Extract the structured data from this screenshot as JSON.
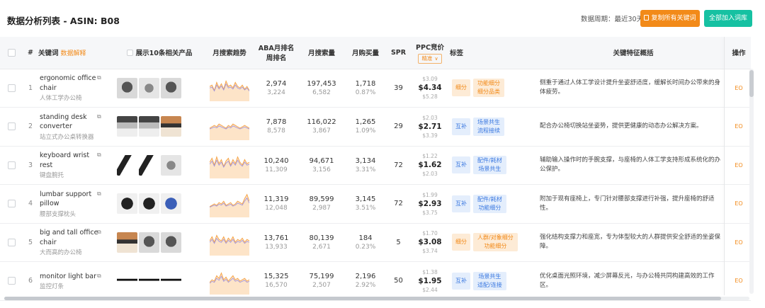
{
  "header": {
    "title": "数据分析列表 - ASIN: B08",
    "period_label": "数据周期：最近30天",
    "copy_button": "复制所有关键词",
    "add_button": "全部加入词库"
  },
  "columns": {
    "index": "#",
    "keyword": "关键词",
    "keyword_sub": "数据解释",
    "products": "展示10条相关产品",
    "trend": "月搜索趋势",
    "aba_line1": "ABA月排名",
    "aba_line2": "周排名",
    "search_volume": "月搜索量",
    "purchase": "月购买量",
    "spr": "SPR",
    "ppc": "PPC竞价",
    "ppc_select": "精准",
    "tags": "标签",
    "features": "关键特征概括",
    "op": "操作"
  },
  "colors": {
    "accent_orange": "#f28a19",
    "accent_green": "#16c1a2",
    "tag_blue": "#3a78e0"
  },
  "rows": [
    {
      "index": "1",
      "kw_en": "ergonomic office chair",
      "kw_cn": "人体工学办公椅",
      "products": [
        "p-dark",
        "p-grey",
        "p-dark"
      ],
      "trend": [
        0.55,
        0.6,
        0.4,
        0.7,
        0.5,
        0.65,
        0.45,
        0.75,
        0.55,
        0.6,
        0.5,
        0.7,
        0.55,
        0.5,
        0.6,
        0.45,
        0.55,
        0.4
      ],
      "aba_month": "2,974",
      "aba_week": "3,224",
      "volume": "197,453",
      "volume_sub": "6,582",
      "purchase": "1,718",
      "purchase_rate": "0.87%",
      "spr": "39",
      "ppc_lo": "$3.09",
      "ppc_mid": "$4.34",
      "ppc_hi": "$5.28",
      "tag_type": "细分",
      "tag_type_style": "orange",
      "tag_lines": [
        "功能细分",
        "细分品类"
      ],
      "tag_style": "orange",
      "feature": "侧重于通过人体工学设计提升坐姿舒适度，缓解长时间办公带来的身体疲劳。",
      "op": "EO"
    },
    {
      "index": "2",
      "kw_en": "standing desk converter",
      "kw_cn": "站立式办公桌转换器",
      "products": [
        "p-desk",
        "p-desk",
        "p-wood"
      ],
      "trend": [
        0.45,
        0.5,
        0.55,
        0.5,
        0.6,
        0.55,
        0.5,
        0.45,
        0.55,
        0.5,
        0.6,
        0.55,
        0.5,
        0.45,
        0.5,
        0.55,
        0.5,
        0.45
      ],
      "aba_month": "7,878",
      "aba_week": "8,578",
      "volume": "116,022",
      "volume_sub": "3,867",
      "purchase": "1,265",
      "purchase_rate": "1.09%",
      "spr": "29",
      "ppc_lo": "$2.03",
      "ppc_mid": "$2.71",
      "ppc_hi": "$3.39",
      "tag_type": "互补",
      "tag_type_style": "blue",
      "tag_lines": [
        "场景共生",
        "流程接续"
      ],
      "tag_style": "blue",
      "feature": "配合办公椅切换站坐姿势，提供更健康的动态办公解决方案。",
      "op": "EO"
    },
    {
      "index": "3",
      "kw_en": "keyboard wrist rest",
      "kw_cn": "键盘腕托",
      "products": [
        "p-wrist",
        "p-wrist",
        "p-grey"
      ],
      "trend": [
        0.6,
        0.75,
        0.5,
        0.8,
        0.55,
        0.7,
        0.45,
        0.65,
        0.75,
        0.5,
        0.7,
        0.55,
        0.8,
        0.6,
        0.5,
        0.7,
        0.55,
        0.6
      ],
      "aba_month": "10,240",
      "aba_week": "11,309",
      "volume": "94,671",
      "volume_sub": "3,156",
      "purchase": "3,134",
      "purchase_rate": "3.31%",
      "spr": "72",
      "ppc_lo": "$1.22",
      "ppc_mid": "$1.62",
      "ppc_hi": "$2.03",
      "tag_type": "互补",
      "tag_type_style": "blue",
      "tag_lines": [
        "配件/耗材",
        "场景共生"
      ],
      "tag_style": "blue",
      "feature": "辅助输入操作时的手腕支撑，与座椅的人体工学支持形成系统化的办公保护。",
      "op": "EO"
    },
    {
      "index": "4",
      "kw_en": "lumbar support pillow",
      "kw_cn": "腰部支撑枕头",
      "products": [
        "p-pill",
        "p-pill",
        "p-pillb"
      ],
      "trend": [
        0.4,
        0.45,
        0.5,
        0.45,
        0.55,
        0.5,
        0.6,
        0.45,
        0.5,
        0.55,
        0.45,
        0.5,
        0.6,
        0.55,
        0.5,
        0.7,
        0.85,
        0.6
      ],
      "aba_month": "11,319",
      "aba_week": "12,048",
      "volume": "89,599",
      "volume_sub": "2,987",
      "purchase": "3,145",
      "purchase_rate": "3.51%",
      "spr": "72",
      "ppc_lo": "$1.99",
      "ppc_mid": "$2.93",
      "ppc_hi": "$3.75",
      "tag_type": "互补",
      "tag_type_style": "blue",
      "tag_lines": [
        "配件/耗材",
        "功能细分"
      ],
      "tag_style": "blue",
      "feature": "附加于现有座椅上，专门针对腰部支撑进行补强，提升座椅的舒适性。",
      "op": "EO"
    },
    {
      "index": "5",
      "kw_en": "big and tall office chair",
      "kw_cn": "大而高的办公椅",
      "products": [
        "p-wood",
        "p-dark",
        "p-dark"
      ],
      "trend": [
        0.55,
        0.7,
        0.5,
        0.75,
        0.6,
        0.55,
        0.7,
        0.5,
        0.65,
        0.55,
        0.7,
        0.5,
        0.6,
        0.55,
        0.65,
        0.5,
        0.6,
        0.55
      ],
      "aba_month": "13,761",
      "aba_week": "13,933",
      "volume": "80,139",
      "volume_sub": "2,671",
      "purchase": "184",
      "purchase_rate": "0.23%",
      "spr": "5",
      "ppc_lo": "$1.70",
      "ppc_mid": "$3.08",
      "ppc_hi": "$3.74",
      "tag_type": "细分",
      "tag_type_style": "orange",
      "tag_lines": [
        "人群/对象细分",
        "功能细分"
      ],
      "tag_style": "orange",
      "feature": "强化结构支撑力和座宽，专为体型较大的人群提供安全舒适的坐姿保障。",
      "op": "EO"
    },
    {
      "index": "6",
      "kw_en": "monitor light bar",
      "kw_cn": "监控灯条",
      "products": [
        "p-lamp",
        "p-lamp",
        "p-lamp"
      ],
      "trend": [
        0.45,
        0.55,
        0.5,
        0.7,
        0.6,
        0.8,
        0.55,
        0.65,
        0.5,
        0.6,
        0.7,
        0.55,
        0.6,
        0.5,
        0.55,
        0.6,
        0.5,
        0.55
      ],
      "aba_month": "15,325",
      "aba_week": "16,570",
      "volume": "75,199",
      "volume_sub": "2,507",
      "purchase": "2,196",
      "purchase_rate": "2.92%",
      "spr": "50",
      "ppc_lo": "$1.38",
      "ppc_mid": "$1.95",
      "ppc_hi": "$2.44",
      "tag_type": "互补",
      "tag_type_style": "blue",
      "tag_lines": [
        "场景共生",
        "适配/连接"
      ],
      "tag_style": "blue",
      "feature": "优化桌面光照环境，减少屏幕反光，与办公椅共同构建高效的工作区。",
      "op": "EO"
    }
  ]
}
